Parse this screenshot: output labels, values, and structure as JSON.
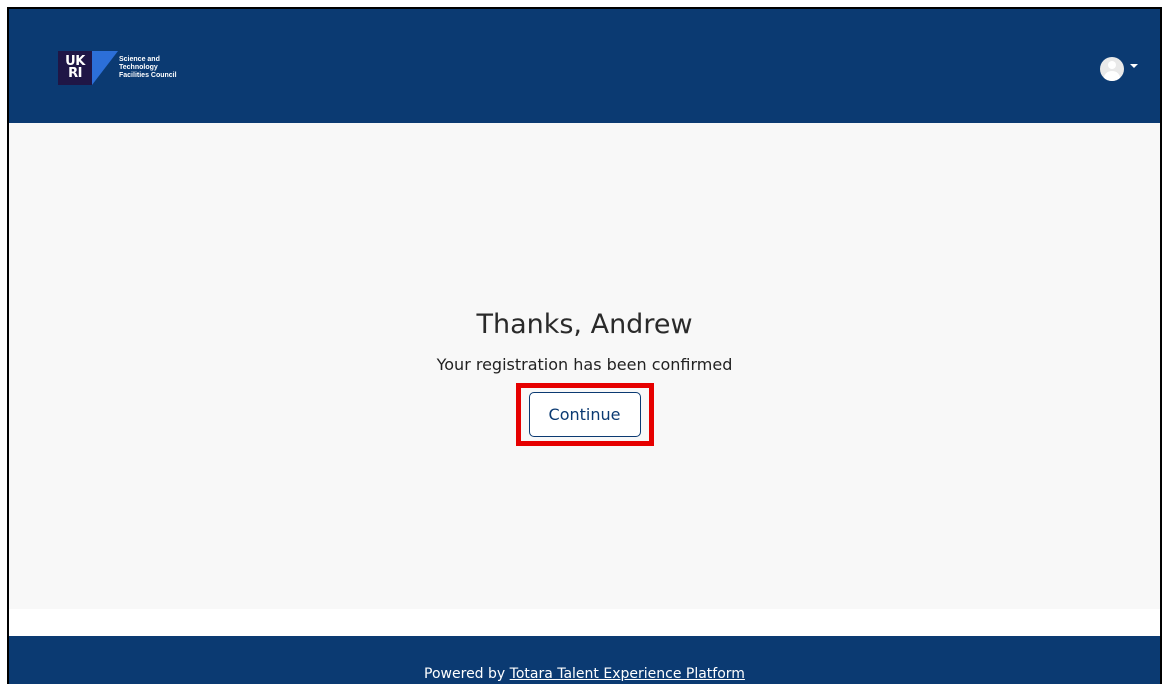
{
  "header": {
    "logo_mark_line1": "UK",
    "logo_mark_line2": "RI",
    "logo_text_line1": "Science and",
    "logo_text_line2": "Technology",
    "logo_text_line3": "Facilities Council",
    "user_icon": "user-avatar-icon",
    "menu_icon": "caret-down-icon"
  },
  "main": {
    "title": "Thanks, Andrew",
    "message": "Your registration has been confirmed",
    "continue_label": "Continue"
  },
  "footer": {
    "prefix": "Powered by ",
    "link_text": "Totara Talent Experience Platform"
  },
  "colors": {
    "header_bg": "#0b3a72",
    "highlight": "#e60000",
    "button_border": "#0b3a72"
  }
}
